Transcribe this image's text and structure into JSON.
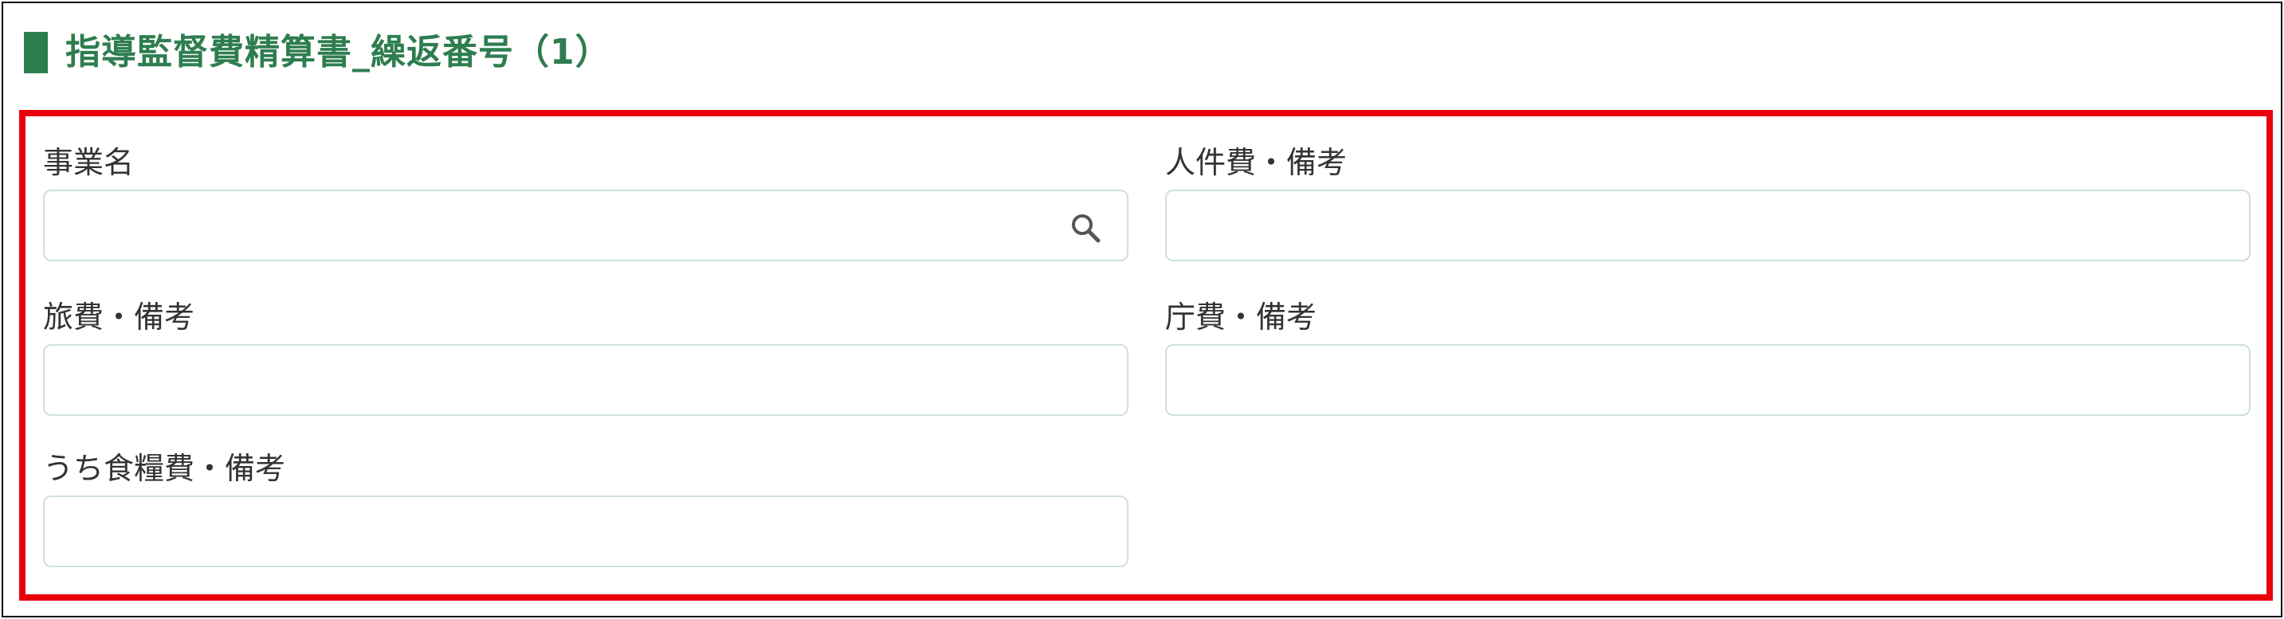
{
  "section": {
    "title": "指導監督費精算書_繰返番号（1）",
    "accent_color": "#2e7d4f",
    "highlight_color": "#e8000b"
  },
  "fields": {
    "business_name": {
      "label": "事業名",
      "value": "",
      "icon": "search-icon"
    },
    "personnel_cost_note": {
      "label": "人件費・備考",
      "value": ""
    },
    "travel_cost_note": {
      "label": "旅費・備考",
      "value": ""
    },
    "office_cost_note": {
      "label": "庁費・備考",
      "value": ""
    },
    "food_cost_note": {
      "label": "うち食糧費・備考",
      "value": ""
    }
  }
}
